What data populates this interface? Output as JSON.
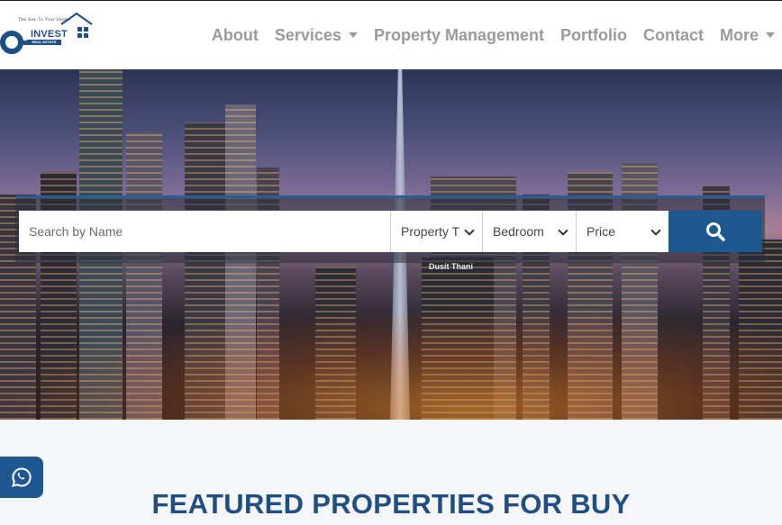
{
  "header": {
    "logo": {
      "tagline": "The Key To Your Home",
      "brand": "INVEST",
      "sub": "REAL ESTATE"
    },
    "nav": [
      {
        "label": "About",
        "dropdown": false
      },
      {
        "label": "Services",
        "dropdown": true
      },
      {
        "label": "Property Management",
        "dropdown": false
      },
      {
        "label": "Portfolio",
        "dropdown": false
      },
      {
        "label": "Contact",
        "dropdown": false
      },
      {
        "label": "More",
        "dropdown": true
      }
    ]
  },
  "search": {
    "placeholder": "Search by Name",
    "property_type": "Property T",
    "bedroom": "Bedroom",
    "price": "Price",
    "button_icon": "search-icon"
  },
  "hero": {
    "sign_text": "Dusit Thani"
  },
  "floating": {
    "whatsapp_icon": "whatsapp-icon"
  },
  "section": {
    "title": "FEATURED PROPERTIES FOR BUY"
  },
  "colors": {
    "brand_blue": "#1f5890",
    "heading_blue": "#1f4f82",
    "nav_gray": "#9a9a9a"
  }
}
